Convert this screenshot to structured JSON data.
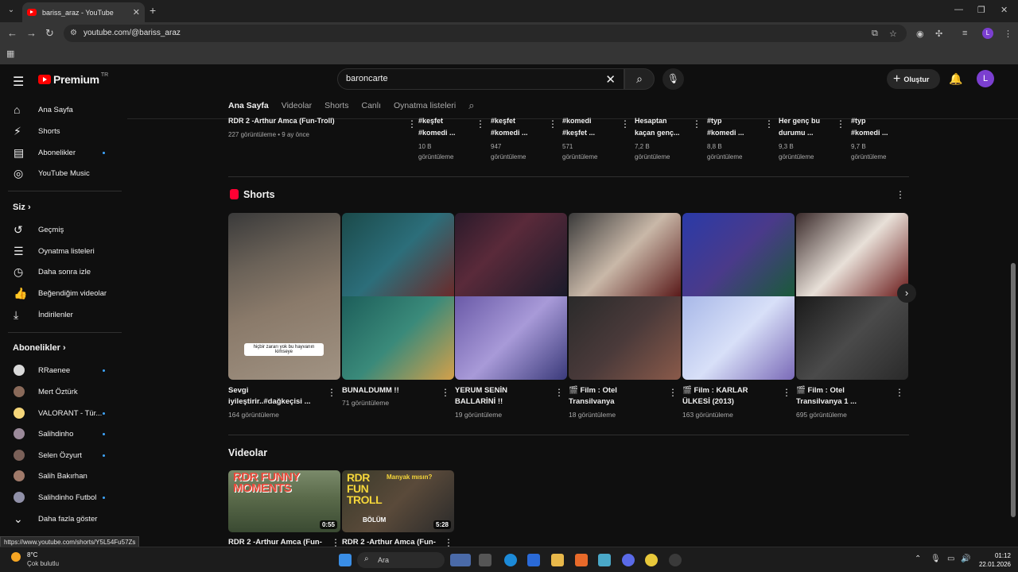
{
  "browser": {
    "tab_title": "bariss_araz - YouTube",
    "url": "youtube.com/@bariss_araz",
    "status_url": "https://www.youtube.com/shorts/Y5L54Fu57Zs",
    "profile_initial": "L"
  },
  "header": {
    "logo_text": "Premium",
    "logo_sup": "TR",
    "search_value": "baroncarte",
    "create_label": "Oluştur",
    "avatar_initial": "L"
  },
  "sidebar": {
    "main": [
      {
        "label": "Ana Sayfa",
        "icon": "home-icon"
      },
      {
        "label": "Shorts",
        "icon": "shorts-icon"
      },
      {
        "label": "Abonelikler",
        "icon": "subscriptions-icon"
      },
      {
        "label": "YouTube Music",
        "icon": "music-icon"
      }
    ],
    "you_header": "Siz",
    "you": [
      {
        "label": "Geçmiş"
      },
      {
        "label": "Oynatma listeleri"
      },
      {
        "label": "Daha sonra izle"
      },
      {
        "label": "Beğendiğim videolar"
      },
      {
        "label": "İndirilenler"
      }
    ],
    "subs_header": "Abonelikler",
    "subs": [
      {
        "label": "RRaenee",
        "color": "#d9d9d9"
      },
      {
        "label": "Mert Öztürk",
        "color": "#8a6a5a"
      },
      {
        "label": "VALORANT - Tür...",
        "color": "#f5d67a"
      },
      {
        "label": "Salihdinho",
        "color": "#9b8a9a"
      },
      {
        "label": "Selen Özyurt",
        "color": "#7a6058"
      },
      {
        "label": "Salih Bakırhan",
        "color": "#a07a6a"
      },
      {
        "label": "Salihdinho Futbol",
        "color": "#9090a8"
      }
    ],
    "show_more": "Daha fazla göster"
  },
  "channel_tabs": [
    "Ana Sayfa",
    "Videolar",
    "Shorts",
    "Canlı",
    "Oynatma listeleri"
  ],
  "top_row": [
    {
      "title": "RDR 2 -Arthur Amca (Fun-Troll)",
      "meta1": "227 görüntüleme • 9 ay önce",
      "meta2": ""
    },
    {
      "title": "#keşfet\n#komedi ...",
      "meta1": "10 B",
      "meta2": "görüntüleme"
    },
    {
      "title": "#keşfet\n#komedi ...",
      "meta1": "947",
      "meta2": "görüntüleme"
    },
    {
      "title": "#komedi\n#keşfet ...",
      "meta1": "571",
      "meta2": "görüntüleme"
    },
    {
      "title": "Hesaptan\nkaçan genç...",
      "meta1": "7,2 B",
      "meta2": "görüntüleme"
    },
    {
      "title": "#typ\n#komedi ...",
      "meta1": "8,8 B",
      "meta2": "görüntüleme"
    },
    {
      "title": "Her genç bu\ndurumu ...",
      "meta1": "9,3 B",
      "meta2": "görüntüleme"
    },
    {
      "title": "#typ\n#komedi ...",
      "meta1": "9,7 B",
      "meta2": "görüntüleme"
    }
  ],
  "shorts_section": {
    "title": "Shorts",
    "caption_overlay": "hiçbir zararı yok bu hayvanın kimseye",
    "items": [
      {
        "title": "Sevgi iyileştirir..#dağkeçisi ...",
        "views": "164 görüntüleme",
        "film": false
      },
      {
        "title": "BUNALDUMM !!",
        "views": "71 görüntüleme",
        "film": false
      },
      {
        "title": "YERUM SENİN BALLARİNİ !!",
        "views": "19 görüntüleme",
        "film": false
      },
      {
        "title": "Film : Otel Transilvanya",
        "views": "18 görüntüleme",
        "film": true
      },
      {
        "title": "Film : KARLAR ÜLKESİ (2013)",
        "views": "163 görüntüleme",
        "film": true
      },
      {
        "title": "Film : Otel Transilvanya 1 ...",
        "views": "695 görüntüleme",
        "film": true
      }
    ]
  },
  "videos_section": {
    "title": "Videolar",
    "items": [
      {
        "thumb_text1": "RDR FUNNY",
        "thumb_text2": "MOMENTS",
        "duration": "0:55",
        "title": "RDR 2 -Arthur Amca (Fun-"
      },
      {
        "thumb_text1": "RDR",
        "thumb_text2": "FUN",
        "thumb_text3": "TROLL",
        "thumb_badge": "Manyak mısın?",
        "thumb_sub": "BÖLÜM",
        "duration": "5:28",
        "title": "RDR 2 -Arthur Amca (Fun-"
      }
    ]
  },
  "taskbar": {
    "temp": "8°C",
    "condition": "Çok bulutlu",
    "search_placeholder": "Ara",
    "time": "01:12",
    "date": "22.01.2026"
  }
}
